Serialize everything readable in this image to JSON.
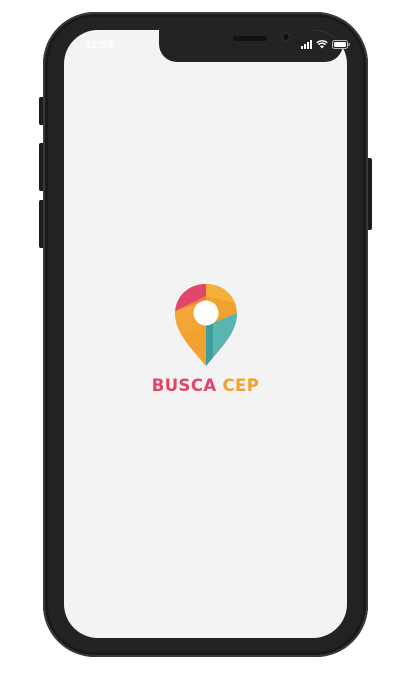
{
  "status_bar": {
    "time": "11:09"
  },
  "app": {
    "name_part1": "BUSCA",
    "name_part2": "CEP"
  },
  "icons": {
    "logo": "map-pin-icon",
    "signal": "signal-icon",
    "wifi": "wifi-icon",
    "battery": "battery-icon"
  },
  "colors": {
    "screen_background": "#f3f3f3",
    "brand_pink": "#e2456a",
    "brand_orange": "#f1a22e",
    "brand_teal": "#59b5b1",
    "device_frame": "#232323"
  }
}
